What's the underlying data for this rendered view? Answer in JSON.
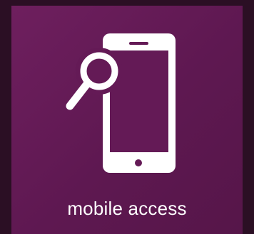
{
  "tile": {
    "label": "mobile access",
    "icon": "phone-search-icon",
    "background_color": "#641a56",
    "outer_background_color": "#2b0f24",
    "foreground_color": "#ffffff"
  }
}
